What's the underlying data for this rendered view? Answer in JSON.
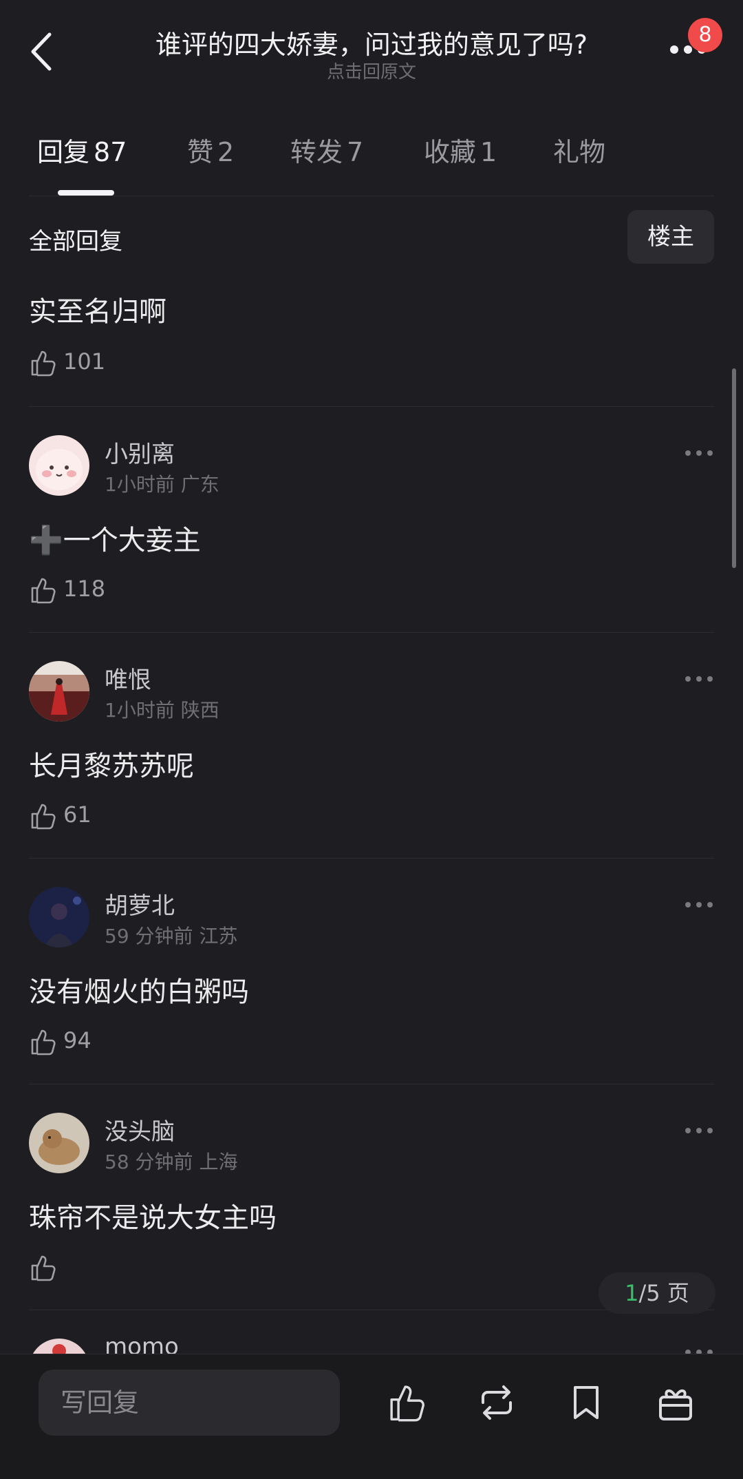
{
  "header": {
    "title": "谁评的四大娇妻，问过我的意见了吗?",
    "subtitle": "点击回原文",
    "badge_count": "8",
    "icons": [
      "back-chevron-icon",
      "more-dots-icon"
    ]
  },
  "tabs": [
    {
      "label": "回复",
      "count": "87",
      "active": true
    },
    {
      "label": "赞",
      "count": "2"
    },
    {
      "label": "转发",
      "count": "7"
    },
    {
      "label": "收藏",
      "count": "1"
    },
    {
      "label": "礼物",
      "count": ""
    }
  ],
  "section": {
    "label": "全部回复",
    "owner_button": "楼主"
  },
  "partial_comment": {
    "text": "实至名归啊",
    "likes": "101"
  },
  "comments": [
    {
      "name": "小别离",
      "time": "1小时前",
      "location": "广东",
      "text": "➕一个大妾主",
      "likes": "118",
      "avatar_color": "#f3d6d8"
    },
    {
      "name": "唯恨",
      "time": "1小时前",
      "location": "陕西",
      "text": "长月黎苏苏呢",
      "likes": "61",
      "avatar_color": "#6a2424"
    },
    {
      "name": "胡萝北",
      "time": "59 分钟前",
      "location": "江苏",
      "text": "没有烟火的白粥吗",
      "likes": "94",
      "avatar_color": "#1e2548"
    },
    {
      "name": "没头脑",
      "time": "58 分钟前",
      "location": "上海",
      "text": "珠帘不是说大女主吗",
      "likes": "",
      "avatar_color": "#b9a58a"
    },
    {
      "name": "momo",
      "time": "",
      "location": "",
      "text": "",
      "likes": "",
      "avatar_color": "#e9c6c8"
    }
  ],
  "pager": {
    "current": "1",
    "rest": "/5 页"
  },
  "bottom_bar": {
    "reply_placeholder": "写回复",
    "icons": [
      "like-icon",
      "repost-icon",
      "bookmark-icon",
      "gift-icon"
    ]
  },
  "colors": {
    "background": "#1e1e22",
    "badge": "#f04a4a",
    "pager_current": "#3bbf6a"
  }
}
